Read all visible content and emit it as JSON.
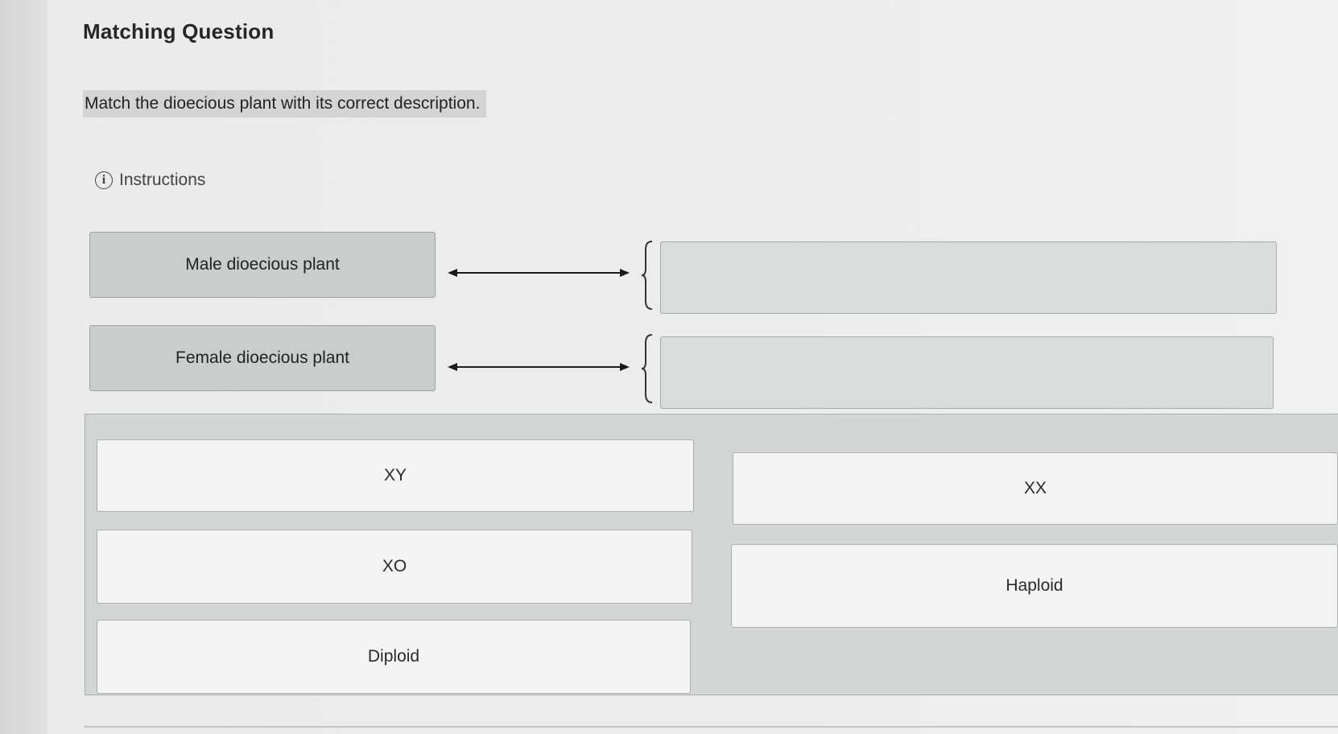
{
  "question": {
    "title": "Matching Question",
    "prompt": "Match the dioecious plant with its correct description.",
    "instructions_label": "Instructions",
    "icon": "info-icon"
  },
  "prompts": [
    {
      "label": "Male dioecious plant"
    },
    {
      "label": "Female dioecious plant"
    }
  ],
  "choices": [
    {
      "label": "XY"
    },
    {
      "label": "XX"
    },
    {
      "label": "XO"
    },
    {
      "label": "Haploid"
    },
    {
      "label": "Diploid"
    }
  ],
  "colors": {
    "prompt_box": "#c9cdcb",
    "drop_zone": "#d9dcdb",
    "choice_box": "#f4f4f4",
    "tray": "#d3d6d5"
  }
}
